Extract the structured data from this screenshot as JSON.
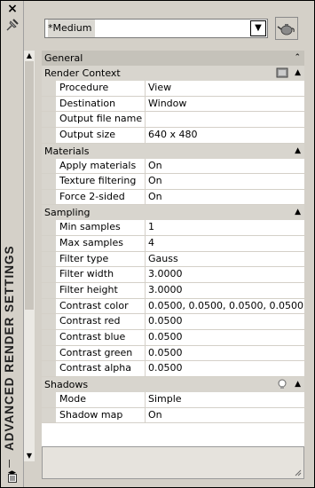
{
  "palette": {
    "title": "ADVANCED RENDER SETTINGS"
  },
  "preset": {
    "selected": "*Medium"
  },
  "sections": [
    {
      "title": "General",
      "rows": []
    },
    {
      "title": "Render Context",
      "rows": [
        {
          "name": "Procedure",
          "value": "View"
        },
        {
          "name": "Destination",
          "value": "Window"
        },
        {
          "name": "Output file name",
          "value": ""
        },
        {
          "name": "Output size",
          "value": "640 x 480"
        }
      ]
    },
    {
      "title": "Materials",
      "rows": [
        {
          "name": "Apply materials",
          "value": "On"
        },
        {
          "name": "Texture filtering",
          "value": "On"
        },
        {
          "name": "Force 2-sided",
          "value": "On"
        }
      ]
    },
    {
      "title": "Sampling",
      "rows": [
        {
          "name": "Min samples",
          "value": "1"
        },
        {
          "name": "Max samples",
          "value": "4"
        },
        {
          "name": "Filter type",
          "value": "Gauss"
        },
        {
          "name": "Filter width",
          "value": "3.0000"
        },
        {
          "name": "Filter height",
          "value": "3.0000"
        },
        {
          "name": "Contrast color",
          "value": "0.0500, 0.0500, 0.0500, 0.0500"
        },
        {
          "name": "Contrast red",
          "value": "0.0500"
        },
        {
          "name": "Contrast blue",
          "value": "0.0500"
        },
        {
          "name": "Contrast green",
          "value": "0.0500"
        },
        {
          "name": "Contrast alpha",
          "value": "0.0500"
        }
      ]
    },
    {
      "title": "Shadows",
      "rows": [
        {
          "name": "Mode",
          "value": "Simple"
        },
        {
          "name": "Shadow map",
          "value": "On"
        }
      ]
    }
  ]
}
